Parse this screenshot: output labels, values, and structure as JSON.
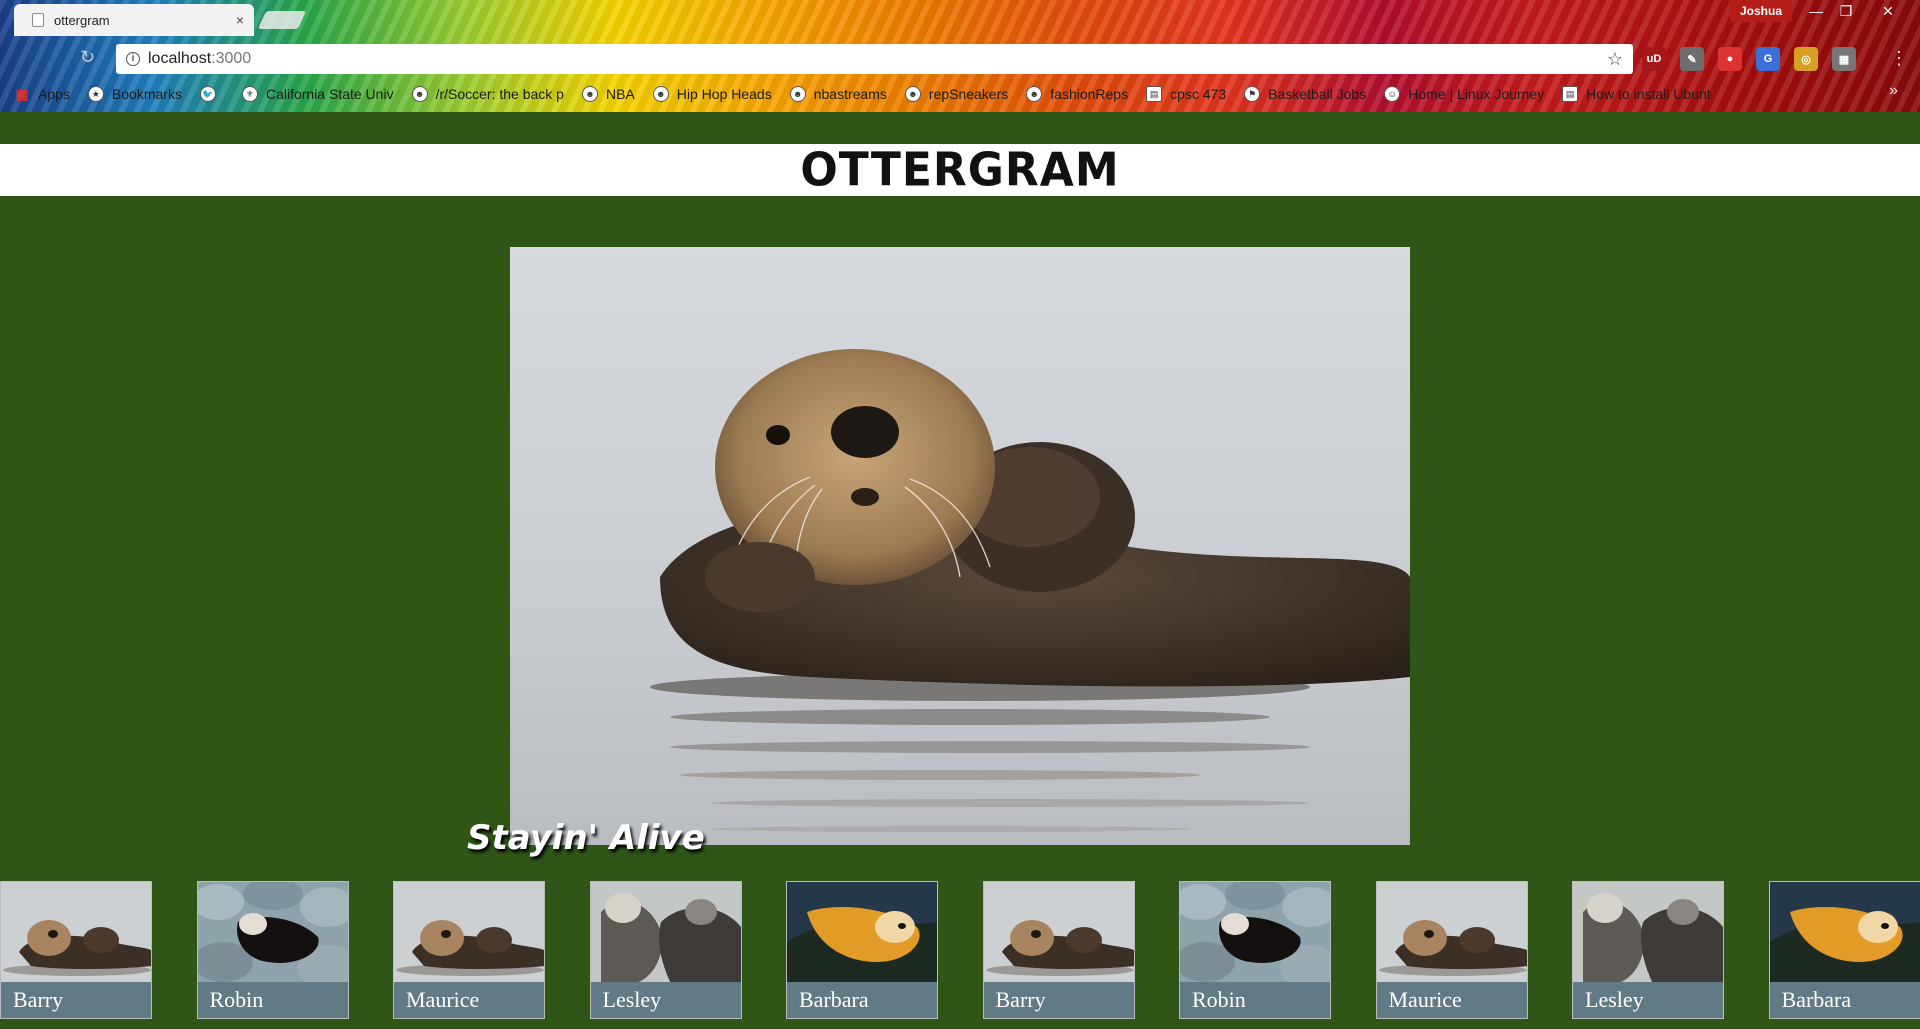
{
  "browser": {
    "tab_title": "ottergram",
    "tab_close": "×",
    "profile_name": "Joshua",
    "url_host": "localhost",
    "url_port": ":3000",
    "window_controls": [
      "—",
      "❐",
      "✕"
    ],
    "extensions": [
      {
        "icon": "ublock-icon",
        "label": "uD",
        "color": "#a4171b"
      },
      {
        "icon": "comment-icon",
        "label": "✎",
        "color": "#6e6e6e"
      },
      {
        "icon": "record-icon",
        "label": "●",
        "color": "#d33"
      },
      {
        "icon": "translate-icon",
        "label": "G",
        "color": "#3b6fd8"
      },
      {
        "icon": "color-icon",
        "label": "◎",
        "color": "#d8a023"
      },
      {
        "icon": "grid-icon",
        "label": "▦",
        "color": "#777"
      }
    ],
    "bookmarks": [
      {
        "label": "Apps",
        "icon": "apps-icon"
      },
      {
        "label": "Bookmarks",
        "icon": "star-icon"
      },
      {
        "label": "",
        "icon": "twitter-icon"
      },
      {
        "label": "California State Univ",
        "icon": "university-icon"
      },
      {
        "label": "/r/Soccer: the back p",
        "icon": "reddit-icon"
      },
      {
        "label": "NBA",
        "icon": "reddit-icon"
      },
      {
        "label": "Hip Hop Heads",
        "icon": "reddit-icon"
      },
      {
        "label": "nbastreams",
        "icon": "reddit-icon"
      },
      {
        "label": "repSneakers",
        "icon": "reddit-icon"
      },
      {
        "label": "fashionReps",
        "icon": "reddit-icon"
      },
      {
        "label": "cpsc 473",
        "icon": "page-icon"
      },
      {
        "label": "Basketball Jobs",
        "icon": "bookmark-icon"
      },
      {
        "label": "Home | Linux Journey",
        "icon": "linux-icon"
      },
      {
        "label": "How to install Ubunt",
        "icon": "page-icon"
      }
    ],
    "bookmarks_more": "»"
  },
  "page": {
    "title": "OTTERGRAM",
    "detail_title": "Stayin' Alive",
    "background_color": "#2f5617",
    "thumbnails": [
      {
        "name": "Barry",
        "variant": "float"
      },
      {
        "name": "Robin",
        "variant": "rocks"
      },
      {
        "name": "Maurice",
        "variant": "float"
      },
      {
        "name": "Lesley",
        "variant": "pair"
      },
      {
        "name": "Barbara",
        "variant": "orange"
      },
      {
        "name": "Barry",
        "variant": "float"
      },
      {
        "name": "Robin",
        "variant": "rocks"
      },
      {
        "name": "Maurice",
        "variant": "float"
      },
      {
        "name": "Lesley",
        "variant": "pair"
      },
      {
        "name": "Barbara",
        "variant": "orange"
      }
    ]
  }
}
